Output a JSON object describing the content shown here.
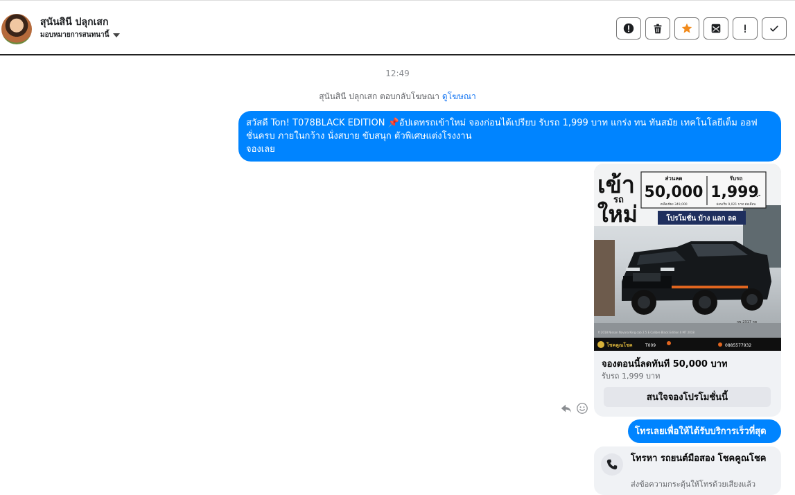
{
  "header": {
    "contact_name": "สุนันสินี ปลุกเสก",
    "assign_label": "มอบหมายการสนทนานี้",
    "actions": [
      {
        "name": "spam-button",
        "icon": "alert-circle-icon"
      },
      {
        "name": "delete-button",
        "icon": "trash-icon"
      },
      {
        "name": "star-button",
        "icon": "star-icon"
      },
      {
        "name": "mark-unread-button",
        "icon": "envelope-icon"
      },
      {
        "name": "priority-button",
        "icon": "exclamation-icon"
      },
      {
        "name": "done-button",
        "icon": "check-icon"
      }
    ]
  },
  "conversation": {
    "timestamp": "12:49",
    "reply_note": "สุนันสินี ปลุกเสก ตอบกลับโฆษณา",
    "reply_note_link": "ดูโฆษณา",
    "message1": {
      "line1": "สวัสดี Ton!  T078BLACK EDITION 📌อัปเดทรถเข้าใหม่ จองก่อนได้เปรียบ รับรถ 1,999 บาท แกร่ง ทน ทันสมัย เทคโนโลยีเต็ม ออฟ",
      "line2": "ชั่นครบ ภายในกว้าง นั่งสบาย ขับสนุก ตัวพิเศษแต่งโรงงาน",
      "line3": "จองเลย"
    },
    "ad_card": {
      "image": {
        "headline_1": "เข้า",
        "headline_2": "รถ",
        "headline_3": "ใหม่",
        "discount_label": "ส่วนลด",
        "discount_value": "50,000",
        "discount_note": "เหลือเพียง 349,000",
        "pickup_label": "รับรถ",
        "pickup_value": "1,999",
        "pickup_unit": ".-",
        "pickup_note": "ผ่อนเริ่ม 9,021 บาท ต่อเดือน",
        "promo_banner": "โปรโมชั่น บ้าง แลก ลด",
        "bottom_brand": "โชคคูณโชค",
        "bottom_code": "T009",
        "bottom_phone": "0885577932",
        "footer_model": "ปี 2018 Nissan Navara King cab 2.5 E Calibre Black Edition II MT 2018",
        "plate_tag": "กข-2317 กท"
      },
      "title": "จองตอนนี้ลดทันที 50,000 บาท",
      "subtitle": "รับรถ 1,999 บาท",
      "button_label": "สนใจจองโปรโมชั่นนี้"
    },
    "message2": "โทรเลยเพื่อให้ได้รับบริการเร็วที่สุด",
    "call_card": {
      "title": "โทรหา รถยนต์มือสอง โชคคูณโชค",
      "subtitle": "ส่งข้อความกระตุ้นให้โทรด้วยเสียงแล้ว"
    }
  },
  "colors": {
    "bubble_blue": "#0084ff",
    "star_orange": "#f28b1c",
    "card_gray": "#f0f2f5"
  }
}
